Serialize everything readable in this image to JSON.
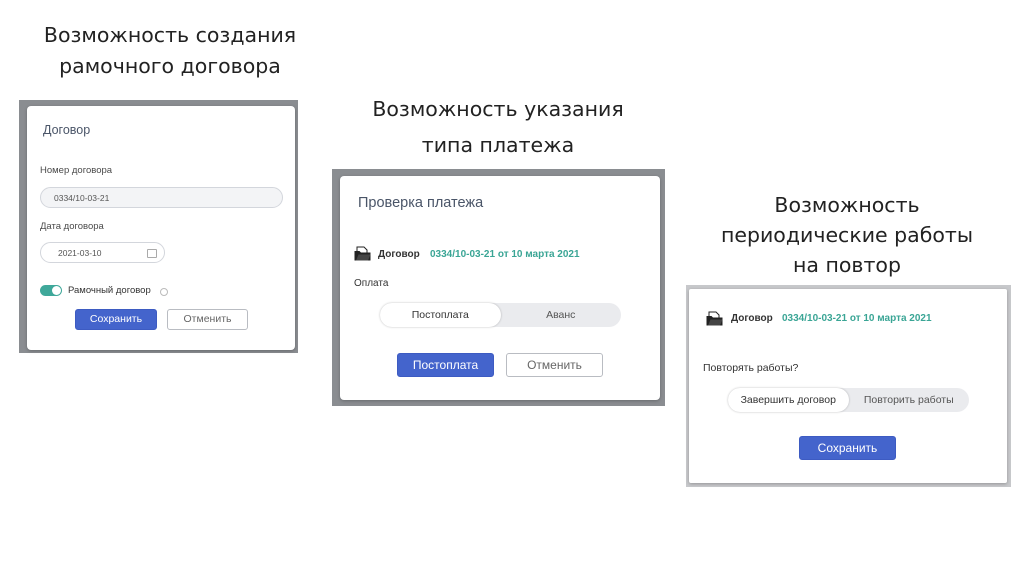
{
  "captions": {
    "create_framework": [
      "Возможность создания",
      "рамочного договора"
    ],
    "payment_type": [
      "Возможность указания",
      "типа платежа"
    ],
    "periodic_work": [
      "Возможность",
      "периодические работы",
      "на повтор"
    ]
  },
  "contract_dialog": {
    "title": "Договор",
    "number_label": "Номер договора",
    "number_value": "0334/10-03-21",
    "date_label": "Дата договора",
    "date_value": "2021-03-10",
    "framework_toggle_label": "Рамочный договор",
    "framework_toggle_on": true,
    "save_label": "Сохранить",
    "cancel_label": "Отменить"
  },
  "payment_dialog": {
    "title": "Проверка платежа",
    "doc_label": "Договор",
    "doc_link": "0334/10-03-21 от 10 марта 2021",
    "payment_label": "Оплата",
    "options": [
      "Постоплата",
      "Аванс"
    ],
    "selected_option": "Постоплата",
    "submit_label": "Постоплата",
    "cancel_label": "Отменить"
  },
  "repeat_dialog": {
    "doc_label": "Договор",
    "doc_link": "0334/10-03-21 от 10 марта 2021",
    "question": "Повторять работы?",
    "options": [
      "Завершить договор",
      "Повторить работы"
    ],
    "selected_option": "Завершить договор",
    "save_label": "Сохранить"
  },
  "colors": {
    "primary": "#4464cc",
    "accent_green": "#3aa595",
    "toggle_on": "#3fa89a"
  }
}
